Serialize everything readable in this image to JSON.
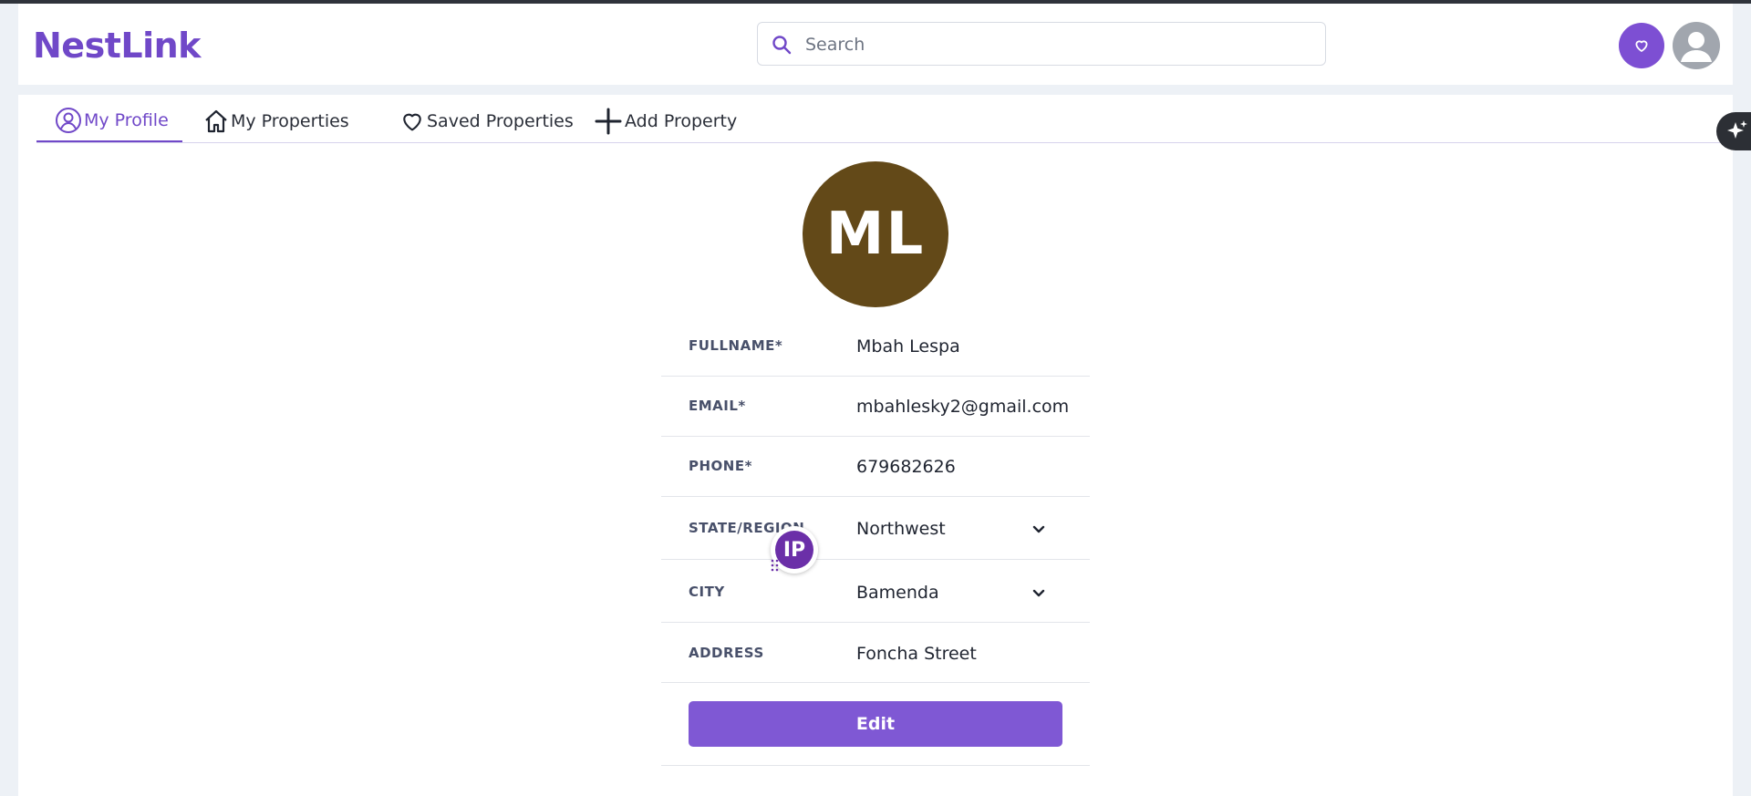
{
  "app": {
    "logo": "NestLink"
  },
  "header": {
    "search_placeholder": "Search",
    "icons": {
      "search": "search-icon",
      "favorites": "heart-icon",
      "user": "user-avatar-icon"
    }
  },
  "tabs": [
    {
      "label": "My Profile",
      "icon": "user-circle-icon",
      "active": true
    },
    {
      "label": "My Properties",
      "icon": "home-icon",
      "active": false
    },
    {
      "label": "Saved Properties",
      "icon": "heart-icon",
      "active": false
    },
    {
      "label": "Add Property",
      "icon": "plus-icon",
      "active": false
    }
  ],
  "profile": {
    "initials": "ML",
    "fields": [
      {
        "label": "FULLNAME*",
        "value": "Mbah Lespa"
      },
      {
        "label": "EMAIL*",
        "value": "mbahlesky2@gmail.com"
      },
      {
        "label": "PHONE*",
        "value": "679682626"
      },
      {
        "label": "STATE/REGION",
        "value": "Northwest",
        "dropdown": true
      },
      {
        "label": "CITY",
        "value": "Bamenda",
        "dropdown": true
      },
      {
        "label": "ADDRESS",
        "value": "Foncha Street"
      }
    ],
    "edit_label": "Edit"
  },
  "overlay": {
    "badge_text": "IP"
  },
  "colors": {
    "accent": "#7048c8",
    "button": "#7f58d4",
    "avatar_bg": "#634918"
  }
}
